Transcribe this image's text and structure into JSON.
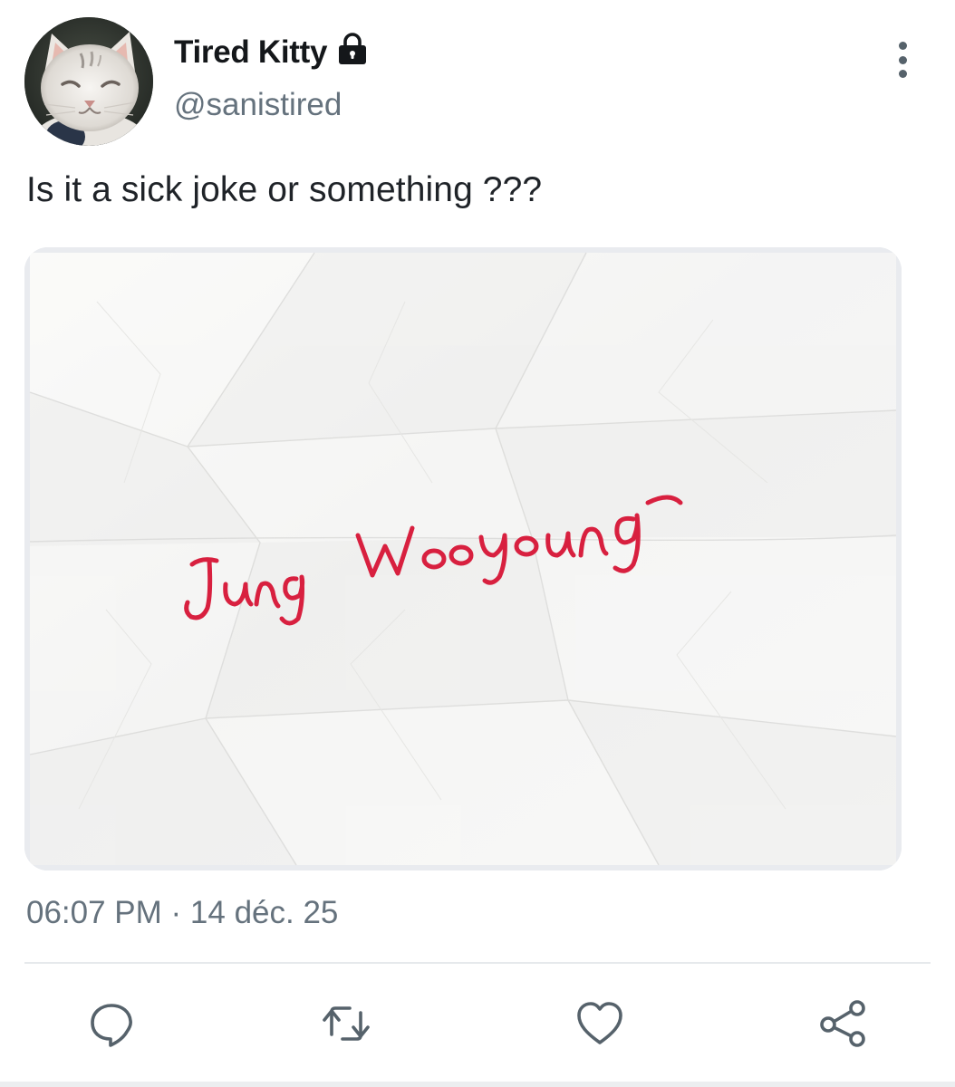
{
  "author": {
    "display_name": "Tired Kitty",
    "handle": "@sanistired",
    "protected_icon": "lock-icon",
    "avatar_icon": "cat-avatar"
  },
  "tweet": {
    "text": "Is it a sick joke or something ???",
    "media": {
      "description_icon": "crumpled-paper-image",
      "handwritten_text": "Jung Wooyoung",
      "ink_color": "#d8203f"
    },
    "timestamp": "06:07 PM · 14 déc. 25"
  },
  "actions": {
    "icons": [
      "reply-icon",
      "retweet-icon",
      "like-icon",
      "share-icon"
    ]
  },
  "colors": {
    "text_primary": "#1f2328",
    "text_secondary": "#65727d",
    "icon": "#56626b"
  }
}
